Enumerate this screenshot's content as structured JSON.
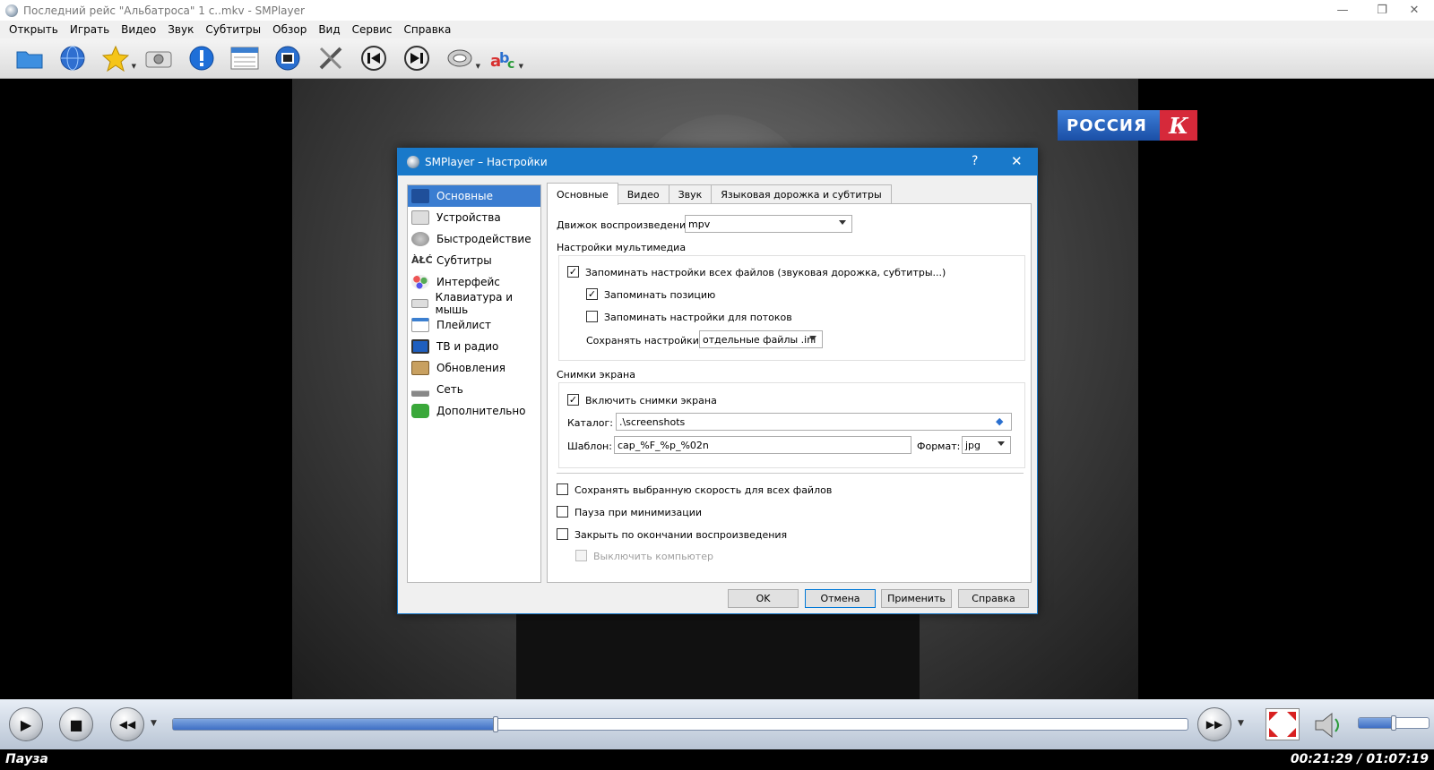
{
  "window": {
    "title": "Последний рейс \"Альбатроса\" 1 c..mkv - SMPlayer",
    "minimize": "—",
    "restore": "❐",
    "close": "✕"
  },
  "menu": [
    "Открыть",
    "Играть",
    "Видео",
    "Звук",
    "Субтитры",
    "Обзор",
    "Вид",
    "Сервис",
    "Справка"
  ],
  "toolbar": {
    "icons": [
      "open-folder-icon",
      "globe-icon",
      "favorites-star-icon",
      "screenshot-camera-icon",
      "info-icon",
      "playlist-icon",
      "video-equalizer-icon",
      "preferences-tools-icon",
      "previous-icon",
      "next-icon",
      "audio-track-icon",
      "subtitles-abc-icon"
    ]
  },
  "video": {
    "logo_text": "РОССИЯ",
    "logo_k": "К"
  },
  "controls": {
    "play": "▶",
    "stop": "■",
    "rewind": "◀◀",
    "forward": "▶▶",
    "seek_fraction": 0.318,
    "volume_fraction": 0.5
  },
  "status": {
    "state": "Пауза",
    "time": "00:21:29 / 01:07:19"
  },
  "dialog": {
    "title": "SMPlayer – Настройки",
    "help": "?",
    "close": "✕",
    "sidebar": [
      {
        "label": "Основные",
        "icon": "general-icon",
        "selected": true
      },
      {
        "label": "Устройства",
        "icon": "devices-icon"
      },
      {
        "label": "Быстродействие",
        "icon": "performance-icon"
      },
      {
        "label": "Субтитры",
        "icon": "subtitles-icon"
      },
      {
        "label": "Интерфейс",
        "icon": "interface-icon"
      },
      {
        "label": "Клавиатура и мышь",
        "icon": "keyboard-icon"
      },
      {
        "label": "Плейлист",
        "icon": "playlist-icon"
      },
      {
        "label": "ТВ и радио",
        "icon": "tv-icon"
      },
      {
        "label": "Обновления",
        "icon": "updates-icon"
      },
      {
        "label": "Сеть",
        "icon": "network-icon"
      },
      {
        "label": "Дополнительно",
        "icon": "advanced-icon"
      }
    ],
    "tabs": [
      "Основные",
      "Видео",
      "Звук",
      "Языковая дорожка и субтитры"
    ],
    "engine_label": "Движок воспроизведения:",
    "engine_value": "mpv",
    "multimedia_label": "Настройки мультимедиа",
    "remember_all": "Запоминать настройки всех файлов (звуковая дорожка, субтитры...)",
    "remember_pos": "Запоминать позицию",
    "remember_streams": "Запоминать настройки для потоков",
    "save_in_label": "Сохранять настройки в",
    "save_in_value": "отдельные файлы .ini",
    "screenshots_label": "Снимки экрана",
    "enable_screens": "Включить снимки экрана",
    "dir_label": "Каталог:",
    "dir_value": ".\\screenshots",
    "template_label": "Шаблон:",
    "template_value": "cap_%F_%p_%02n",
    "format_label": "Формат:",
    "format_value": "jpg",
    "keep_speed": "Сохранять выбранную скорость для всех файлов",
    "pause_min": "Пауза при минимизации",
    "close_end": "Закрыть по окончании воспроизведения",
    "shutdown": "Выключить компьютер",
    "check": "✓",
    "buttons": {
      "ok": "OK",
      "cancel": "Отмена",
      "apply": "Применить",
      "help": "Справка"
    }
  }
}
